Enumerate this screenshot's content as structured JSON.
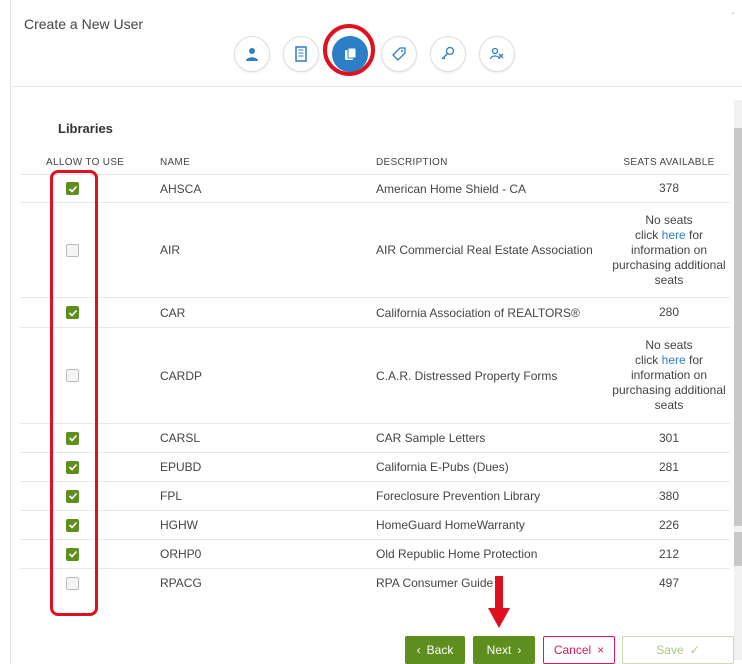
{
  "header": {
    "title": "Create a New User"
  },
  "steps": [
    {
      "icon": "user-icon",
      "active": false
    },
    {
      "icon": "building-icon",
      "active": false
    },
    {
      "icon": "documents-icon",
      "active": true
    },
    {
      "icon": "tag-icon",
      "active": false
    },
    {
      "icon": "key-icon",
      "active": false
    },
    {
      "icon": "users-icon",
      "active": false
    }
  ],
  "section": {
    "title": "Libraries"
  },
  "table": {
    "columns": [
      "ALLOW TO USE",
      "NAME",
      "DESCRIPTION",
      "SEATS AVAILABLE"
    ],
    "rows": [
      {
        "checked": true,
        "name": "AHSCA",
        "description": "American Home Shield - CA",
        "seats": "378"
      },
      {
        "checked": false,
        "name": "AIR",
        "description": "AIR Commercial Real Estate Association",
        "seats_no": "No seats",
        "seats_click": "click",
        "seats_link": "here",
        "seats_for": "for",
        "seats_info": "information on purchasing additional seats"
      },
      {
        "checked": true,
        "name": "CAR",
        "description": "California Association of REALTORS®",
        "seats": "280"
      },
      {
        "checked": false,
        "name": "CARDP",
        "description": "C.A.R. Distressed Property Forms",
        "seats_no": "No seats",
        "seats_click": "click",
        "seats_link": "here",
        "seats_for": "for",
        "seats_info": "information on purchasing additional seats"
      },
      {
        "checked": true,
        "name": "CARSL",
        "description": "CAR Sample Letters",
        "seats": "301"
      },
      {
        "checked": true,
        "name": "EPUBD",
        "description": "California E-Pubs (Dues)",
        "seats": "281"
      },
      {
        "checked": true,
        "name": "FPL",
        "description": "Foreclosure Prevention Library",
        "seats": "380"
      },
      {
        "checked": true,
        "name": "HGHW",
        "description": "HomeGuard HomeWarranty",
        "seats": "226"
      },
      {
        "checked": true,
        "name": "ORHP0",
        "description": "Old Republic Home Protection",
        "seats": "212"
      },
      {
        "checked": false,
        "name": "RPACG",
        "description": "RPA Consumer Guide",
        "seats": "497"
      }
    ]
  },
  "footer": {
    "back_label": "Back",
    "back_icon": "‹",
    "next_label": "Next",
    "next_icon": "›",
    "cancel_label": "Cancel",
    "cancel_icon": "×",
    "save_label": "Save",
    "save_icon": "✓"
  },
  "colors": {
    "accent_green": "#5e8f1e",
    "active_blue": "#2a7fc6",
    "highlight_red": "#e0101e",
    "cancel_pink": "#d81b60"
  }
}
